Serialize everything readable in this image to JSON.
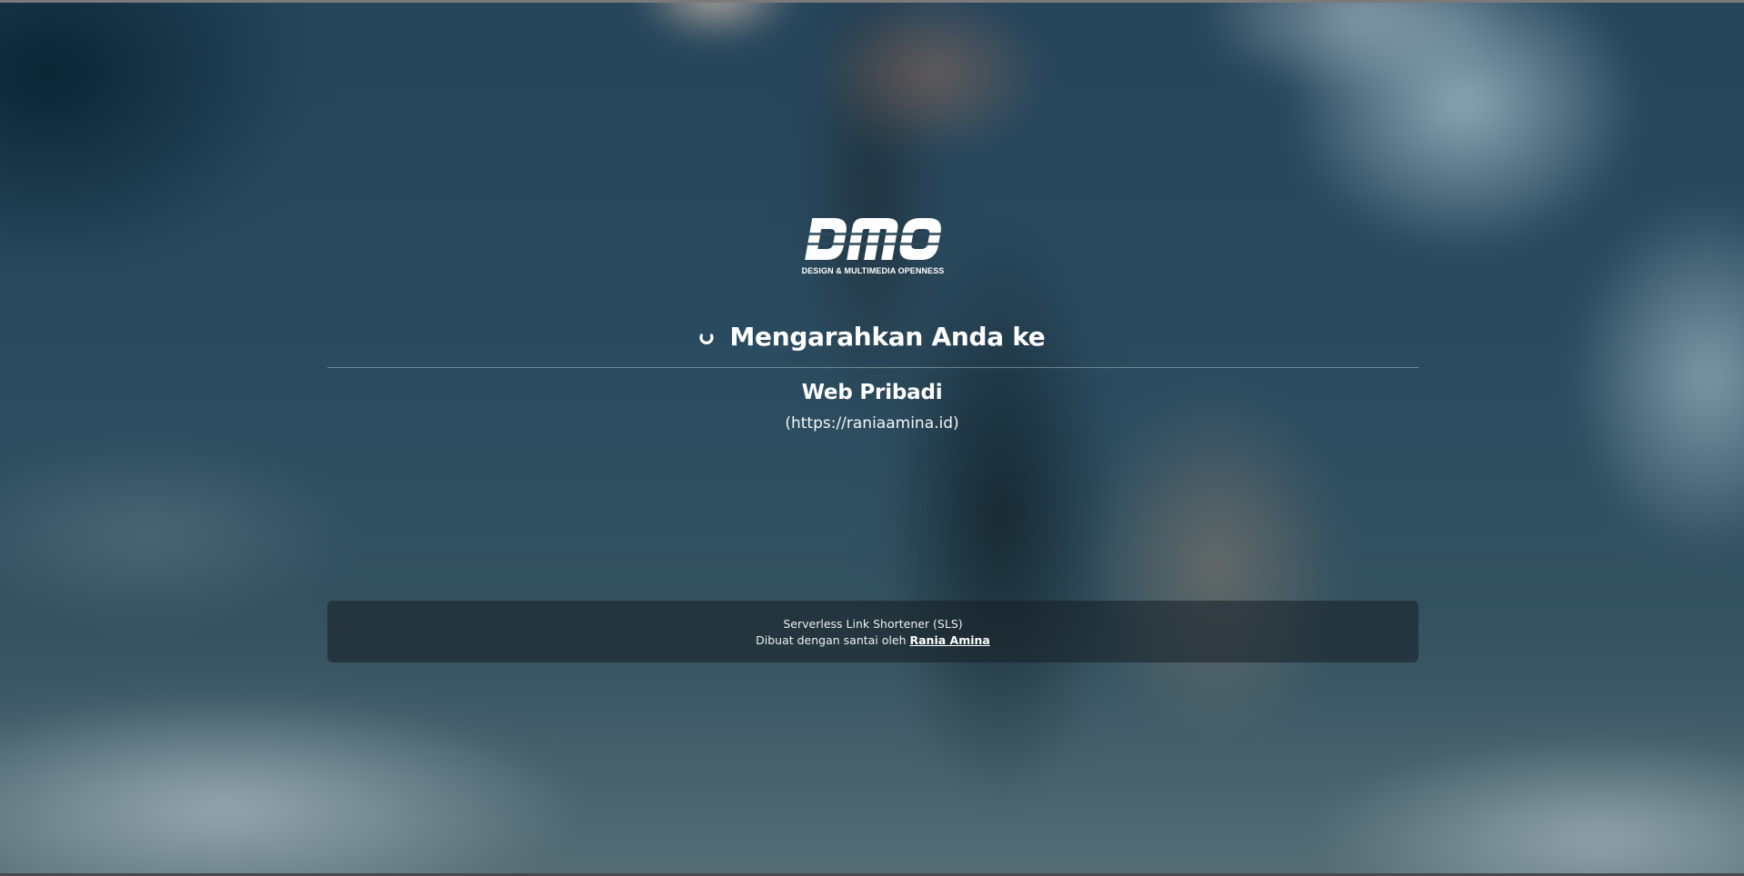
{
  "brand": {
    "logo_text": "DMO",
    "tagline": "DESIGN & MULTIMEDIA OPENNESS"
  },
  "redirect": {
    "heading": "Mengarahkan Anda ke",
    "spinner_icon": "loading-spinner-icon",
    "destination_title": "Web Pribadi",
    "destination_url": "(https://raniaamina.id)"
  },
  "footer": {
    "app_name": "Serverless Link Shortener (SLS)",
    "credit_prefix": "Dibuat dengan santai oleh",
    "credit_author": "Rania Amina"
  },
  "colors": {
    "text": "#ffffff",
    "footer_bg": "rgba(22,30,36,0.55)",
    "background_base": "#243b4b"
  }
}
